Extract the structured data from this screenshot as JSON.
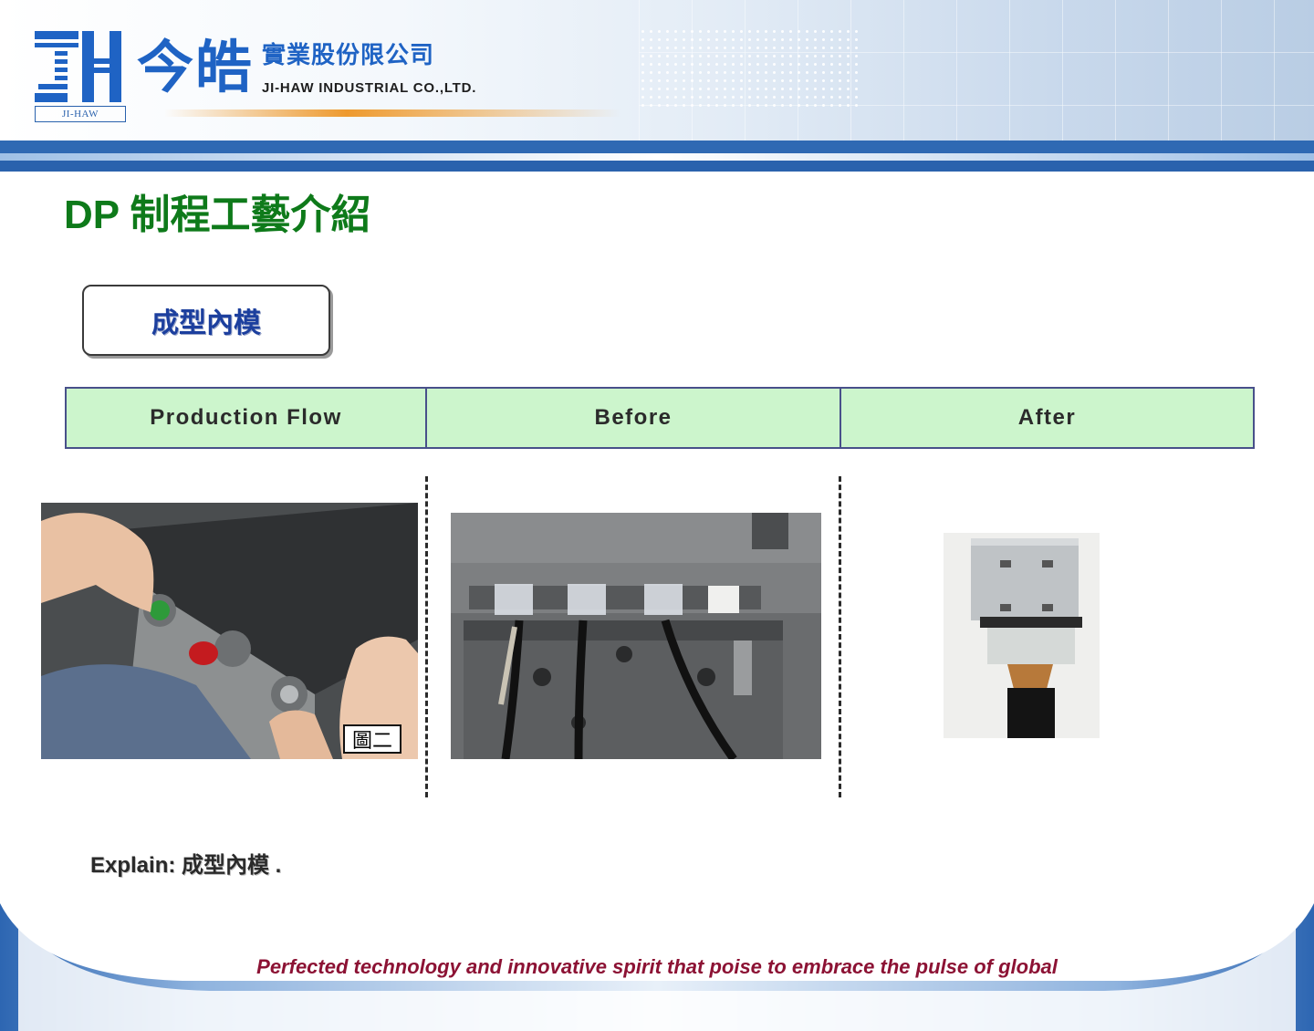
{
  "header": {
    "logo_letters": "JH",
    "logo_small": "JI-HAW",
    "company_cn_large": "今皓",
    "company_cn_small": "實業股份限公司",
    "company_en": "JI-HAW INDUSTRIAL CO.,LTD."
  },
  "title": "DP 制程工藝介紹",
  "step_label": "成型內模",
  "table": {
    "columns": [
      "Production Flow",
      "Before",
      "After"
    ]
  },
  "photos": {
    "flow_photo_label": "圖二"
  },
  "explain": "Explain:  成型內模 .",
  "footer": {
    "slogan": "Perfected technology and innovative spirit that poise to embrace the pulse of global"
  },
  "colors": {
    "brand_blue": "#1f63c4",
    "title_green": "#0e7a1a",
    "table_fill": "#ccf5cc",
    "slogan_red": "#8c1234"
  }
}
